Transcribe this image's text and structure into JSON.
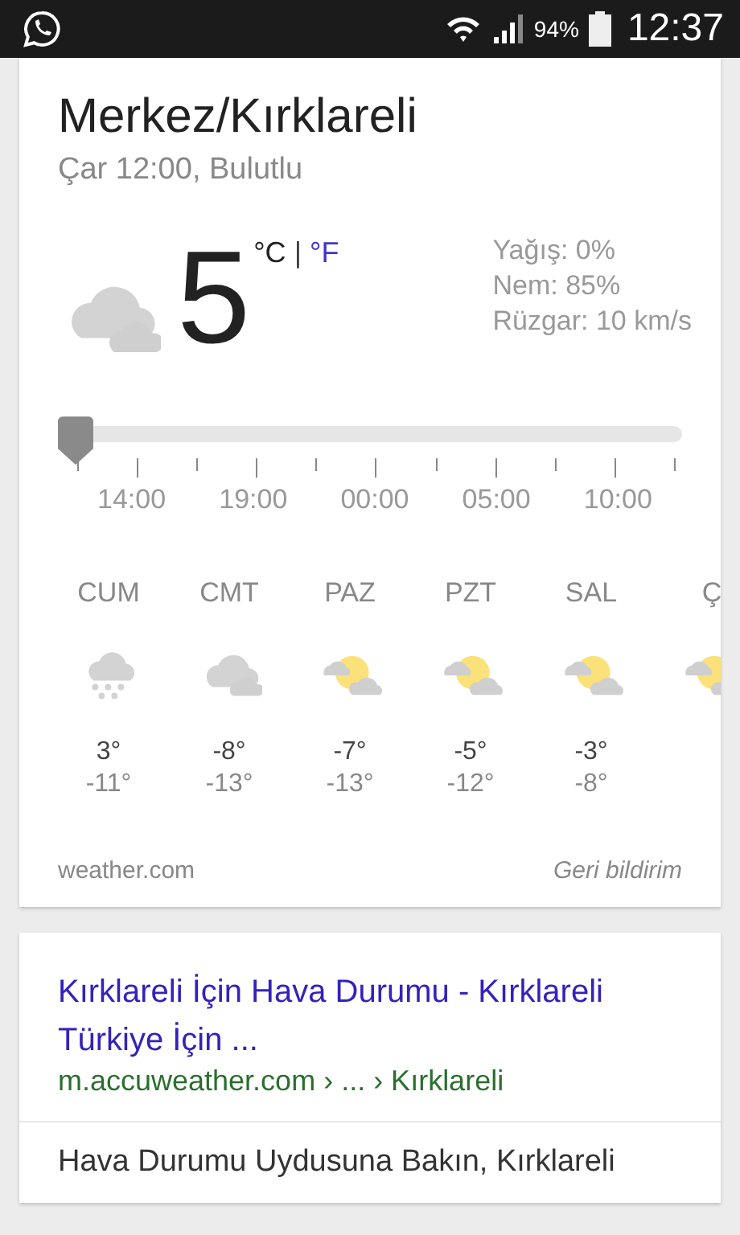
{
  "status_bar": {
    "battery": "94%",
    "time": "12:37"
  },
  "weather_card": {
    "title_lines": [
      "Merkez/Kırklareli"
    ],
    "subtitle": "Çar 12:00, Bulutlu",
    "condition": {
      "kind": "cloudy"
    },
    "temperature": "5",
    "separator": "|",
    "units": [
      {
        "label": "°C",
        "selected": true
      },
      {
        "label": "°F",
        "selected": false
      }
    ],
    "details": [
      "Yağış: 0%",
      "Nem: 85%",
      "Rüzgar: 10 km/s"
    ],
    "timeline": {
      "level": 0,
      "times": [
        "14:00",
        "19:00",
        "00:00",
        "05:00",
        "10:00"
      ]
    },
    "forecast": [
      {
        "day": "CUM",
        "kind": "snow",
        "high": "3°",
        "low": "-11°"
      },
      {
        "day": "CMT",
        "kind": "cloudy",
        "high": "-8°",
        "low": "-13°"
      },
      {
        "day": "PAZ",
        "kind": "partly-sunny",
        "high": "-7°",
        "low": "-13°"
      },
      {
        "day": "PZT",
        "kind": "partly-sunny",
        "high": "-5°",
        "low": "-12°"
      },
      {
        "day": "SAL",
        "kind": "partly-sunny",
        "high": "-3°",
        "low": "-8°"
      },
      {
        "day": "Ç",
        "kind": "partly-sunny"
      }
    ],
    "source": "weather.com",
    "feedback": "Geri bildirim"
  },
  "result_card": {
    "title": "Kırklareli İçin Hava Durumu - Kırklareli Türkiye İçin ...",
    "url": "m.accuweather.com › ... › Kırklareli",
    "snippet": "Hava Durumu Uydusuna Bakın, Kırklareli"
  }
}
